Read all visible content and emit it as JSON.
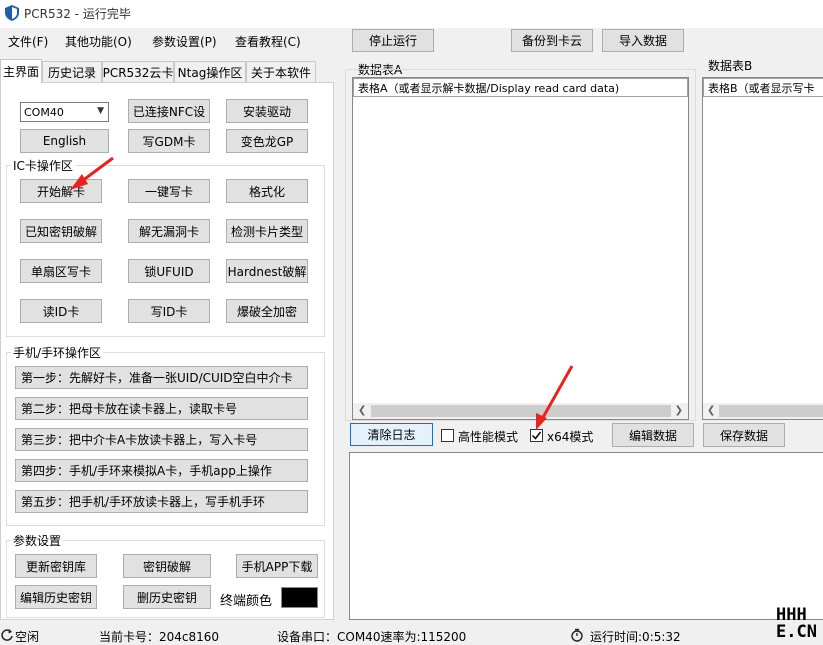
{
  "window": {
    "title": "PCR532 - 运行完毕"
  },
  "menu": {
    "file": "文件(F)",
    "other": "其他功能(O)",
    "params": "参数设置(P)",
    "tutorial": "查看教程(C)"
  },
  "toolbar": {
    "stop": "停止运行",
    "backup": "备份到卡云",
    "import": "导入数据"
  },
  "tabs": [
    "主界面",
    "历史记录",
    "PCR532云卡",
    "Ntag操作区",
    "关于本软件"
  ],
  "top_controls": {
    "com_port": "COM40",
    "nfc_status": "已连接NFC设",
    "install_driver": "安装驱动",
    "english": "English",
    "write_gdm": "写GDM卡",
    "chameleon": "变色龙GP"
  },
  "ic_group": {
    "label": "IC卡操作区",
    "buttons": [
      "开始解卡",
      "一键写卡",
      "格式化",
      "已知密钥破解",
      "解无漏洞卡",
      "检测卡片类型",
      "单扇区写卡",
      "锁UFUID",
      "Hardnest破解",
      "读ID卡",
      "写ID卡",
      "爆破全加密"
    ]
  },
  "phone_group": {
    "label": "手机/手环操作区",
    "steps": [
      "第一步：先解好卡，准备一张UID/CUID空白中介卡",
      "第二步：把母卡放在读卡器上，读取卡号",
      "第三步：把中介卡A卡放读卡器上，写入卡号",
      "第四步：手机/手环来模拟A卡，手机app上操作",
      "第五步：把手机/手环放读卡器上，写手机手环"
    ]
  },
  "param_group": {
    "label": "参数设置",
    "update_keys": "更新密钥库",
    "crack_key": "密钥破解",
    "download_app": "手机APP下载",
    "edit_history": "编辑历史密钥",
    "delete_history": "删历史密钥",
    "terminal_color_label": "终端颜色",
    "terminal_color": "#000000"
  },
  "table_a": {
    "label": "数据表A",
    "header": "表格A（或者显示解卡数据/Display read card data)"
  },
  "table_b": {
    "label": "数据表B",
    "header": "表格B（或者显示写卡"
  },
  "actions": {
    "clear_log": "清除日志",
    "high_perf_label": "高性能模式",
    "high_perf_checked": false,
    "x64_label": "x64模式",
    "x64_checked": true,
    "edit_data": "编辑数据",
    "save_data": "保存数据"
  },
  "status": {
    "state": "空闲",
    "card_number": "当前卡号：204c8160",
    "device_port": "设备串口：COM40速率为:115200",
    "run_time": "运行时间:0:5:32"
  },
  "watermark": "HHH E.CN",
  "colors": {
    "annotation_arrow": "#e8231f",
    "selected_button_border": "#0078d7"
  }
}
